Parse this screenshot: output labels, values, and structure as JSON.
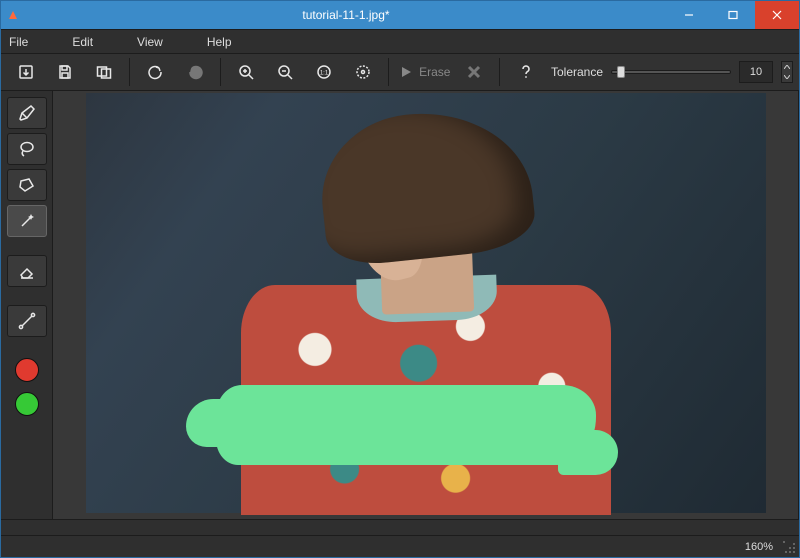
{
  "title": "tutorial-11-1.jpg*",
  "menu": {
    "file": "File",
    "edit": "Edit",
    "view": "View",
    "help": "Help"
  },
  "toolbar": {
    "erase_label": "Erase",
    "tolerance_label": "Tolerance",
    "tolerance_value": "10"
  },
  "status": {
    "zoom": "160%"
  },
  "colors": {
    "accent": "#3b8bc9",
    "marker_red": "#e03a2f",
    "marker_green": "#36c936",
    "mask_green": "#6ce499"
  }
}
